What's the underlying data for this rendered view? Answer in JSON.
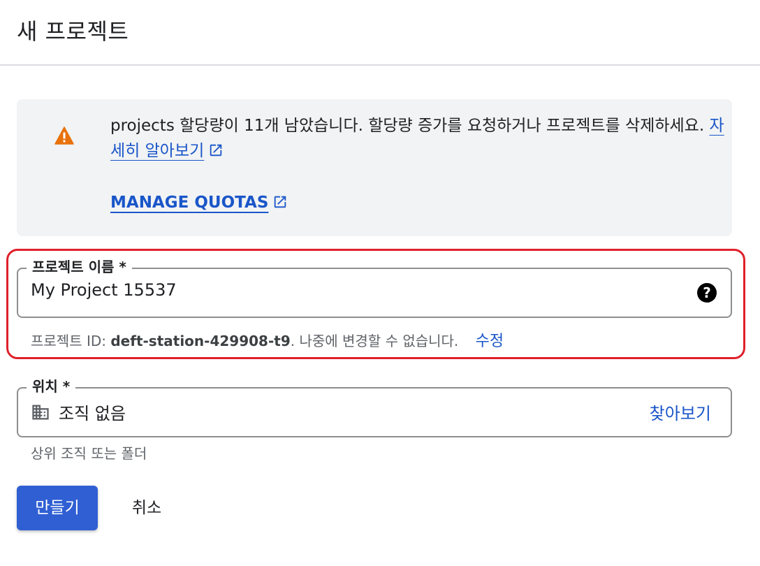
{
  "header": {
    "title": "새 프로젝트"
  },
  "quota_banner": {
    "message": "projects 할당량이 11개 남았습니다. 할당량 증가를 요청하거나 프로젝트를 삭제하세요.",
    "learn_more_label": "자세히 알아보기",
    "manage_quotas_label": "MANAGE QUOTAS"
  },
  "project_name": {
    "label": "프로젝트 이름 *",
    "value": "My Project 15537",
    "help_icon": "help-icon"
  },
  "project_id": {
    "prefix": "프로젝트 ID:",
    "id": "deft-station-429908-t9",
    "suffix": ". 나중에 변경할 수 없습니다.",
    "edit_label": "수정"
  },
  "location": {
    "label": "위치 *",
    "value": "조직 없음",
    "icon": "organization-icon",
    "browse_label": "찾아보기",
    "helper": "상위 조직 또는 폴더"
  },
  "actions": {
    "create_label": "만들기",
    "cancel_label": "취소"
  },
  "colors": {
    "accent": "#1a56c9",
    "primary_button": "#2f5fd3",
    "highlight": "#e0202a",
    "warning": "#e8710a"
  }
}
